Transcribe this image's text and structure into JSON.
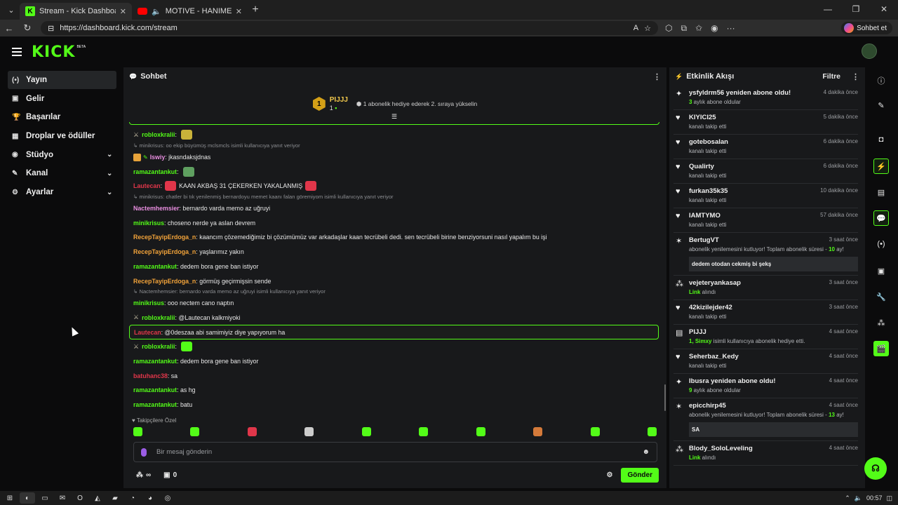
{
  "browser": {
    "tabs": [
      {
        "title": "Stream - Kick Dashboard",
        "active": true
      },
      {
        "title": "MOTIVE - HANIMEFENDİ (Offi",
        "active": false
      }
    ],
    "url": "https://dashboard.kick.com/stream",
    "copilot_label": "Sohbet et"
  },
  "logo": {
    "text": "KICK",
    "beta": "BETA"
  },
  "sidebar": {
    "items": [
      {
        "label": "Yayın",
        "icon": "broadcast-icon",
        "glyph": "(•)",
        "active": true,
        "expand": false
      },
      {
        "label": "Gelir",
        "icon": "revenue-icon",
        "glyph": "▣",
        "active": false,
        "expand": false
      },
      {
        "label": "Başarılar",
        "icon": "trophy-icon",
        "glyph": "🏆",
        "active": false,
        "expand": false
      },
      {
        "label": "Droplar ve ödüller",
        "icon": "gift-icon",
        "glyph": "▦",
        "active": false,
        "expand": false
      },
      {
        "label": "Stüdyo",
        "icon": "studio-icon",
        "glyph": "◉",
        "active": false,
        "expand": true
      },
      {
        "label": "Kanal",
        "icon": "channel-icon",
        "glyph": "✎",
        "active": false,
        "expand": true
      },
      {
        "label": "Ayarlar",
        "icon": "settings-icon",
        "glyph": "⚙",
        "active": false,
        "expand": true
      }
    ]
  },
  "chat": {
    "title": "Sohbet",
    "goal": {
      "user": "PIJJJ",
      "rank": "1",
      "count": "1",
      "text": "1 abonelik hediye ederek 2. sıraya yükselin"
    },
    "followers_label": "Takipçilere Özel",
    "input_placeholder": "Bir mesaj gönderin",
    "viewers": "∞",
    "gifts": "0",
    "send_label": "Gönder",
    "messages": [
      {
        "kind": "msg",
        "user": "robloxkralii",
        "color": "gr",
        "text": "",
        "sword": true,
        "emote": "#c9b23a"
      },
      {
        "kind": "reply",
        "text": "↳ minikrisus: oo ekip büyümüş mclsmcls isimli kullanıcıya yanıt veriyor"
      },
      {
        "kind": "msg",
        "user": "Iswiy",
        "color": "pk",
        "text": "jkasndaksjdnas",
        "badge": true
      },
      {
        "kind": "msg",
        "user": "ramazantankut",
        "color": "gr",
        "text": "",
        "emote": "#5fa060"
      },
      {
        "kind": "msg",
        "user": "Lautecan",
        "color": "rd",
        "text": "KAAN AKBAŞ 31 ÇEKERKEN YAKALANMIŞ",
        "emote": "#e0364a",
        "emote2": "#e0364a"
      },
      {
        "kind": "reply",
        "text": "↳ minikrisus: chatler bi tık yenilenmiş bernardoyu memet kaanı falan göremiyom isimli kullanıcıya yanıt veriyor"
      },
      {
        "kind": "msg",
        "user": "Nactemhemsier",
        "color": "pk",
        "text": "bernardo varda memo az uğruyi"
      },
      {
        "kind": "msg",
        "user": "minikrisus",
        "color": "gr",
        "text": "choseno nerde ya aslan devrem"
      },
      {
        "kind": "msg",
        "user": "RecepTayipErdoga_n",
        "color": "or",
        "text": "kaancım çözemediğimiz bi çözümümüz var arkadaşlar kaan tecrübeli dedi. sen tecrübeli birine benziyorsuni nasıl yapalım bu işi"
      },
      {
        "kind": "msg",
        "user": "RecepTayipErdoga_n",
        "color": "or",
        "text": "yaşlarımız yakın"
      },
      {
        "kind": "msg",
        "user": "ramazantankut",
        "color": "gr",
        "text": "dedem bora gene ban istiyor"
      },
      {
        "kind": "msg",
        "user": "RecepTayipErdoga_n",
        "color": "or",
        "text": "görmüş geçirmişsin sende"
      },
      {
        "kind": "reply",
        "text": "↳ Nactemhemsier: bernardo varda memo az uğruyi  isimli kullanıcıya yanıt veriyor"
      },
      {
        "kind": "msg",
        "user": "minikrisus",
        "color": "gr",
        "text": "ooo nectem cano naptın"
      },
      {
        "kind": "msg",
        "user": "robloxkralii",
        "color": "gr",
        "text": "@Lautecan kalkmiyoki",
        "sword": true
      },
      {
        "kind": "msg",
        "user": "Lautecan",
        "color": "rd",
        "text": "@0deszaa abi samimiyiz diye yapıyorum ha",
        "highlight": true
      },
      {
        "kind": "msg",
        "user": "robloxkralii",
        "color": "gr",
        "text": "",
        "sword": true,
        "emote": "#53fc18"
      },
      {
        "kind": "msg",
        "user": "ramazantankut",
        "color": "gr",
        "text": "dedem bora gene ban istiyor"
      },
      {
        "kind": "msg",
        "user": "batuhanc38",
        "color": "rd",
        "text": "sa"
      },
      {
        "kind": "msg",
        "user": "ramazantankut",
        "color": "gr",
        "text": "as hg"
      },
      {
        "kind": "msg",
        "user": "ramazantankut",
        "color": "gr",
        "text": "batu"
      }
    ]
  },
  "feed": {
    "title": "Etkinlik Akışı",
    "filter_label": "Filtre",
    "events": [
      {
        "icon": "sparkle-icon",
        "glyph": "✦",
        "user": "ysfyldrm56 yeniden abone oldu!",
        "time": "4 dakika önce",
        "hl": "3",
        "sub": " aylık abone oldular"
      },
      {
        "icon": "heart-icon",
        "glyph": "♥",
        "user": "KIYICI25",
        "time": "5 dakika önce",
        "sub": "kanalı takip etti"
      },
      {
        "icon": "heart-icon",
        "glyph": "♥",
        "user": "gotebosalan",
        "time": "6 dakika önce",
        "sub": "kanalı takip etti"
      },
      {
        "icon": "heart-icon",
        "glyph": "♥",
        "user": "Qualirty",
        "time": "6 dakika önce",
        "sub": "kanalı takip etti"
      },
      {
        "icon": "heart-icon",
        "glyph": "♥",
        "user": "furkan35k35",
        "time": "10 dakika önce",
        "sub": "kanalı takip etti"
      },
      {
        "icon": "heart-icon",
        "glyph": "♥",
        "user": "IAMTYMO",
        "time": "57 dakika önce",
        "sub": "kanalı takip etti"
      },
      {
        "icon": "party-icon",
        "glyph": "✶",
        "user": "BertugVT",
        "time": "3 saat önce",
        "sub": "abonelik yenilemesini kutluyor! Toplam abonelik süresi - ",
        "hl_end": "10",
        "sub2": " ay!",
        "quote": "dedem otodan cekmiş bi şekş"
      },
      {
        "icon": "drop-icon",
        "glyph": "⁂",
        "user": "vejeteryankasap",
        "time": "3 saat önce",
        "hl": "Link",
        "sub": " alındı"
      },
      {
        "icon": "heart-icon",
        "glyph": "♥",
        "user": "42kizilejder42",
        "time": "3 saat önce",
        "sub": "kanalı takip etti"
      },
      {
        "icon": "gift-sub-icon",
        "glyph": "▤",
        "user": "PIJJJ",
        "time": "4 saat önce",
        "hl": "1, Simxy",
        "sub": " isimli kullanıcıya abonelik hediye etti."
      },
      {
        "icon": "heart-icon",
        "glyph": "♥",
        "user": "Seherbaz_Kedy",
        "time": "4 saat önce",
        "sub": "kanalı takip etti"
      },
      {
        "icon": "sparkle-icon",
        "glyph": "✦",
        "user": "Ibusra yeniden abone oldu!",
        "time": "4 saat önce",
        "hl": "9",
        "sub": " aylık abone oldular"
      },
      {
        "icon": "party-icon",
        "glyph": "✶",
        "user": "epicchirp45",
        "time": "4 saat önce",
        "sub": "abonelik yenilemesini kutluyor! Toplam abonelik süresi - ",
        "hl_end": "13",
        "sub2": " ay!",
        "quote": "SA"
      },
      {
        "icon": "drop-icon",
        "glyph": "⁂",
        "user": "Blody_SoloLeveling",
        "time": "4 saat önce",
        "hl": "Link",
        "sub": " alındı"
      }
    ]
  },
  "taskbar": {
    "time": "00:57"
  }
}
